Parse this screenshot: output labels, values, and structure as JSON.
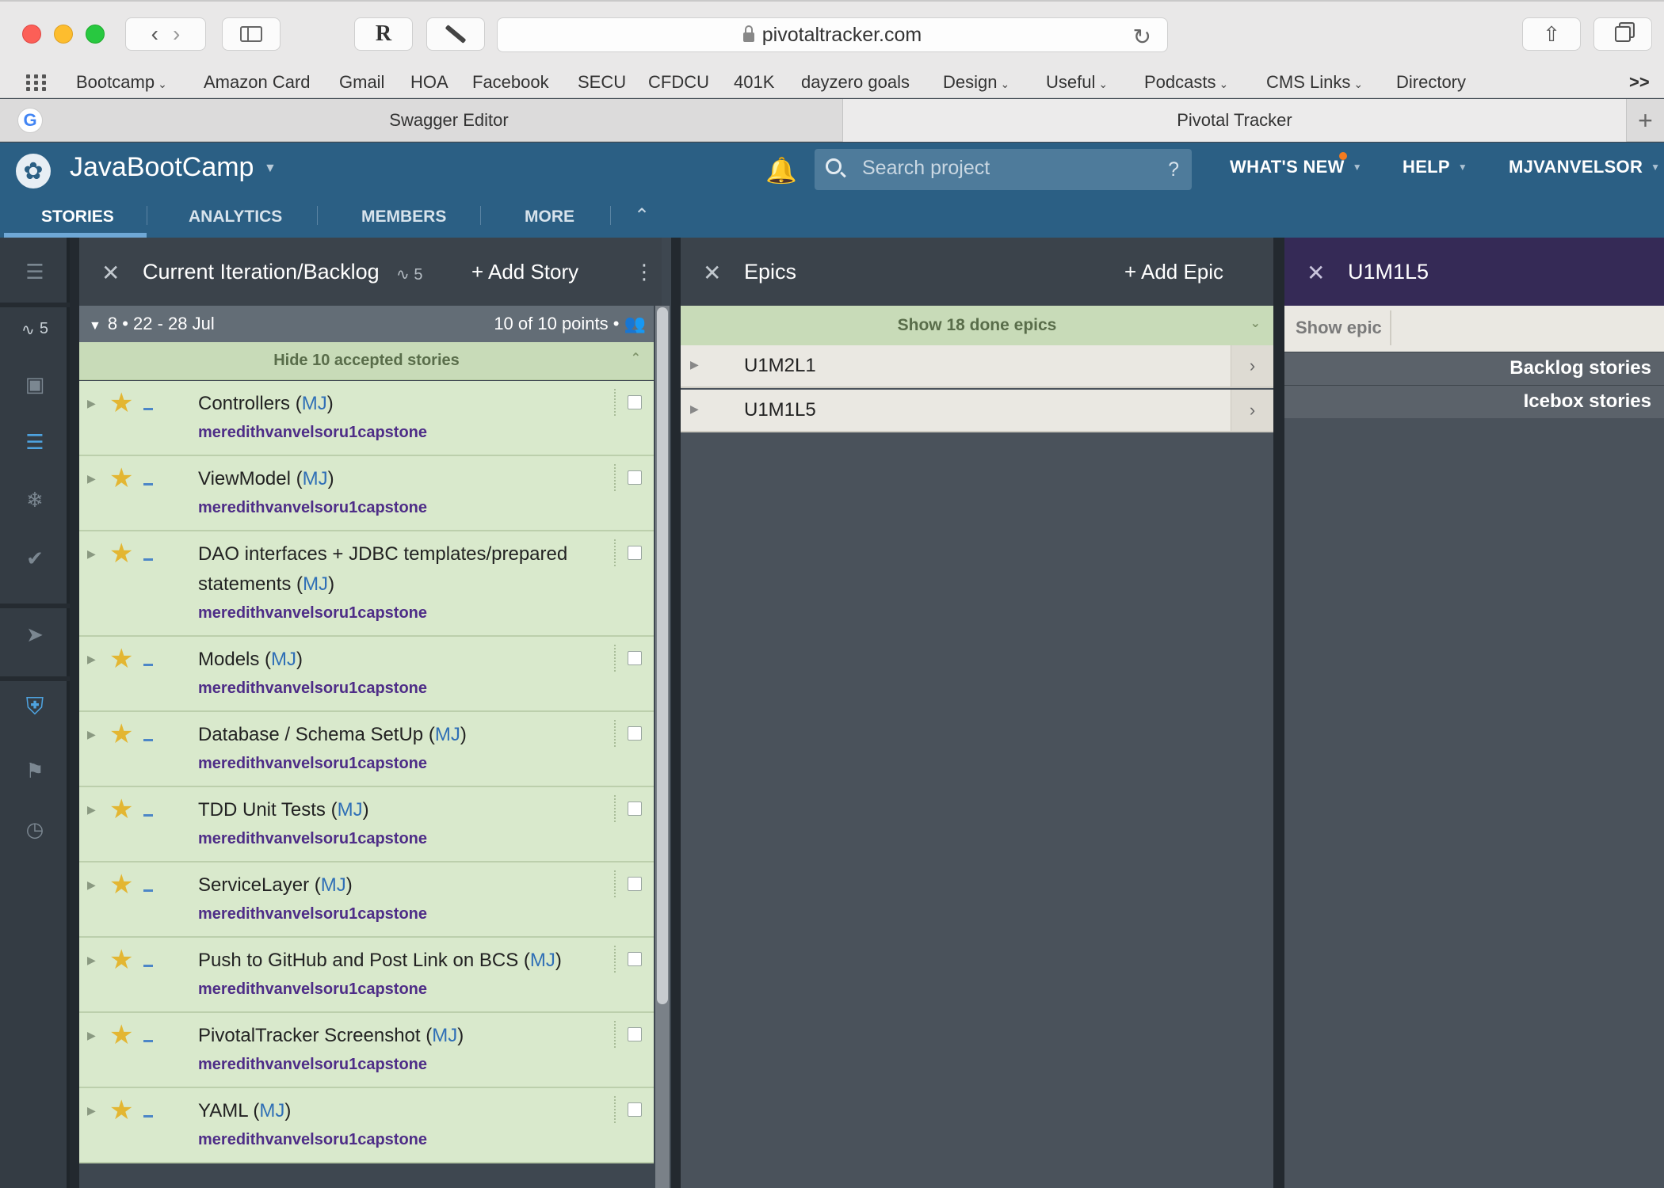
{
  "browser": {
    "url": "pivotaltracker.com",
    "bookmarks": [
      {
        "label": "Bootcamp",
        "has_menu": true
      },
      {
        "label": "Amazon Card",
        "has_menu": false
      },
      {
        "label": "Gmail",
        "has_menu": false
      },
      {
        "label": "HOA",
        "has_menu": false
      },
      {
        "label": "Facebook",
        "has_menu": false
      },
      {
        "label": "SECU",
        "has_menu": false
      },
      {
        "label": "CFDCU",
        "has_menu": false
      },
      {
        "label": "401K",
        "has_menu": false
      },
      {
        "label": "dayzero goals",
        "has_menu": false
      },
      {
        "label": "Design",
        "has_menu": true
      },
      {
        "label": "Useful",
        "has_menu": true
      },
      {
        "label": "Podcasts",
        "has_menu": true
      },
      {
        "label": "CMS Links",
        "has_menu": true
      },
      {
        "label": "Directory",
        "has_menu": false
      }
    ],
    "overflow": ">>",
    "tabs": [
      "Swagger Editor",
      "Pivotal Tracker"
    ],
    "active_tab": "Pivotal Tracker"
  },
  "app": {
    "project_name": "JavaBootCamp",
    "search_placeholder": "Search project",
    "search_help": "?",
    "nav": [
      "WHAT'S NEW",
      "HELP",
      "MJVANVELSOR"
    ],
    "tabs": [
      "STORIES",
      "ANALYTICS",
      "MEMBERS",
      "MORE"
    ],
    "active_tab": "STORIES",
    "accent_color": "#2b5f84"
  },
  "sidebar": {
    "velocity": "5",
    "icons": [
      "menu-icon",
      "velocity-icon",
      "icebox-tray-icon",
      "backlog-list-icon",
      "icebox-snowflake-icon",
      "done-check-icon",
      "pin-icon",
      "epics-badge-icon",
      "labels-tag-icon",
      "history-clock-icon"
    ]
  },
  "backlog": {
    "title": "Current Iteration/Backlog",
    "velocity": "5",
    "add_label": "Add Story",
    "iteration_label": "8 • 22 - 28 Jul",
    "points_label": "10 of 10 points •",
    "accepted_toggle": "Hide 10 accepted stories",
    "stories": [
      {
        "title": "Controllers",
        "owner": "MJ",
        "label": "meredithvanvelsoru1capstone"
      },
      {
        "title": "ViewModel",
        "owner": "MJ",
        "label": "meredithvanvelsoru1capstone"
      },
      {
        "title": "DAO interfaces + JDBC templates/prepared statements",
        "owner": "MJ",
        "label": "meredithvanvelsoru1capstone"
      },
      {
        "title": "Models",
        "owner": "MJ",
        "label": "meredithvanvelsoru1capstone"
      },
      {
        "title": "Database / Schema SetUp",
        "owner": "MJ",
        "label": "meredithvanvelsoru1capstone"
      },
      {
        "title": "TDD Unit Tests",
        "owner": "MJ",
        "label": "meredithvanvelsoru1capstone"
      },
      {
        "title": "ServiceLayer",
        "owner": "MJ",
        "label": "meredithvanvelsoru1capstone"
      },
      {
        "title": "Push to GitHub and Post Link on BCS",
        "owner": "MJ",
        "label": "meredithvanvelsoru1capstone"
      },
      {
        "title": "PivotalTracker Screenshot",
        "owner": "MJ",
        "label": "meredithvanvelsoru1capstone"
      },
      {
        "title": "YAML",
        "owner": "MJ",
        "label": "meredithvanvelsoru1capstone"
      }
    ],
    "story_color": "#d9e9cc"
  },
  "epics": {
    "title": "Epics",
    "add_label": "Add Epic",
    "done_toggle": "Show 18 done epics",
    "items": [
      "U1M2L1",
      "U1M1L5"
    ]
  },
  "epic_detail": {
    "title": "U1M1L5",
    "show_epic": "Show epic",
    "sections": [
      "Backlog stories",
      "Icebox stories"
    ],
    "header_color": "#352a56"
  }
}
